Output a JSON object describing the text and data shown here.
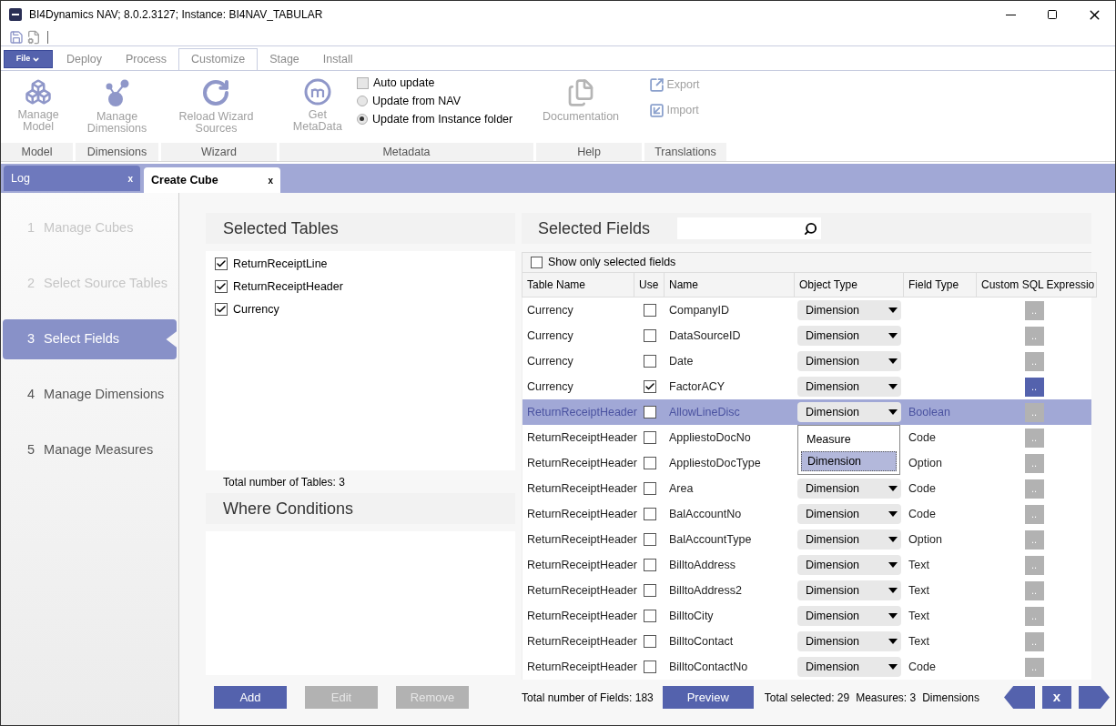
{
  "window": {
    "title": "BI4Dynamics NAV; 8.0.2.3127;  Instance: BI4NAV_TABULAR"
  },
  "file_menu": {
    "label": "File"
  },
  "ribbon_tabs": [
    {
      "label": "Deploy",
      "selected": false
    },
    {
      "label": "Process",
      "selected": false
    },
    {
      "label": "Customize",
      "selected": true
    },
    {
      "label": "Stage",
      "selected": false
    },
    {
      "label": "Install",
      "selected": false
    }
  ],
  "ribbon_groups": [
    {
      "label": "Model",
      "items": [
        {
          "kind": "large",
          "label": "Manage\nModel"
        }
      ]
    },
    {
      "label": "Dimensions",
      "items": [
        {
          "kind": "large",
          "label": "Manage\nDimensions"
        }
      ]
    },
    {
      "label": "Wizard",
      "items": [
        {
          "kind": "large",
          "label": "Reload Wizard\nSources"
        }
      ]
    },
    {
      "label": "Metadata",
      "items": [
        {
          "kind": "large",
          "label": "Get\nMetaData"
        },
        {
          "kind": "checkbox",
          "label": "Auto update",
          "checked": false
        },
        {
          "kind": "radio",
          "label": "Update from NAV",
          "selected": false
        },
        {
          "kind": "radio",
          "label": "Update from Instance folder",
          "selected": true
        }
      ]
    },
    {
      "label": "Help",
      "items": [
        {
          "kind": "large",
          "label": "Documentation"
        }
      ]
    },
    {
      "label": "Translations",
      "items": [
        {
          "kind": "small",
          "label": "Export"
        },
        {
          "kind": "small",
          "label": "Import"
        }
      ]
    }
  ],
  "doc_tabs": [
    {
      "label": "Log",
      "close": "x",
      "selected": false
    },
    {
      "label": "Create Cube",
      "close": "x",
      "selected": true
    }
  ],
  "steps": [
    {
      "number": "1",
      "label": "Manage Cubes",
      "selected": false,
      "disabled": true
    },
    {
      "number": "2",
      "label": "Select Source Tables",
      "selected": false,
      "disabled": true
    },
    {
      "number": "3",
      "label": "Select Fields",
      "selected": true,
      "disabled": false
    },
    {
      "number": "4",
      "label": "Manage Dimensions",
      "selected": false,
      "disabled": false
    },
    {
      "number": "5",
      "label": "Manage Measures",
      "selected": false,
      "disabled": false
    }
  ],
  "selected_tables": {
    "title": "Selected Tables",
    "items": [
      {
        "label": "ReturnReceiptLine",
        "checked": true
      },
      {
        "label": "ReturnReceiptHeader",
        "checked": true
      },
      {
        "label": "Currency",
        "checked": true
      }
    ],
    "total": "Total number of Tables: 3"
  },
  "where_conditions": {
    "title": "Where Conditions"
  },
  "condition_buttons": [
    {
      "label": "Add",
      "disabled": false
    },
    {
      "label": "Edit",
      "disabled": true
    },
    {
      "label": "Remove",
      "disabled": true
    }
  ],
  "selected_fields": {
    "title": "Selected Fields",
    "show_only": {
      "label": "Show only selected fields",
      "checked": false
    },
    "columns": [
      "Table Name",
      "Use",
      "Name",
      "Object Type",
      "Field Type",
      "Custom SQL Expressio"
    ],
    "rows": [
      {
        "table": "Currency",
        "use": false,
        "name": "CompanyID",
        "object_type": "Dimension",
        "sql": "..",
        "highlighted": false,
        "selected": false
      },
      {
        "table": "Currency",
        "use": false,
        "name": "DataSourceID",
        "object_type": "Dimension",
        "sql": "..",
        "highlighted": false,
        "selected": false
      },
      {
        "table": "Currency",
        "use": false,
        "name": "Date",
        "object_type": "Dimension",
        "sql": "..",
        "highlighted": false,
        "selected": false
      },
      {
        "table": "Currency",
        "use": true,
        "name": "FactorACY",
        "object_type": "Dimension",
        "sql": "..",
        "highlighted": true,
        "selected": false
      },
      {
        "table": "ReturnReceiptHeader",
        "use": false,
        "name": "AllowLineDisc",
        "object_type": "Dimension",
        "field_type": "Boolean",
        "sql": "..",
        "highlighted": false,
        "selected": true
      },
      {
        "table": "ReturnReceiptHeader",
        "use": false,
        "name": "AppliestoDocNo",
        "field_type": "Code",
        "sql": "..",
        "highlighted": false,
        "selected": false
      },
      {
        "table": "ReturnReceiptHeader",
        "use": false,
        "name": "AppliestoDocType",
        "field_type": "Option",
        "sql": "..",
        "highlighted": false,
        "selected": false
      },
      {
        "table": "ReturnReceiptHeader",
        "use": false,
        "name": "Area",
        "object_type": "Dimension",
        "field_type": "Code",
        "sql": "..",
        "highlighted": false,
        "selected": false
      },
      {
        "table": "ReturnReceiptHeader",
        "use": false,
        "name": "BalAccountNo",
        "object_type": "Dimension",
        "field_type": "Code",
        "sql": "..",
        "highlighted": false,
        "selected": false
      },
      {
        "table": "ReturnReceiptHeader",
        "use": false,
        "name": "BalAccountType",
        "object_type": "Dimension",
        "field_type": "Option",
        "sql": "..",
        "highlighted": false,
        "selected": false
      },
      {
        "table": "ReturnReceiptHeader",
        "use": false,
        "name": "BilltoAddress",
        "object_type": "Dimension",
        "field_type": "Text",
        "sql": "..",
        "highlighted": false,
        "selected": false
      },
      {
        "table": "ReturnReceiptHeader",
        "use": false,
        "name": "BilltoAddress2",
        "object_type": "Dimension",
        "field_type": "Text",
        "sql": "..",
        "highlighted": false,
        "selected": false
      },
      {
        "table": "ReturnReceiptHeader",
        "use": false,
        "name": "BilltoCity",
        "object_type": "Dimension",
        "field_type": "Text",
        "sql": "..",
        "highlighted": false,
        "selected": false
      },
      {
        "table": "ReturnReceiptHeader",
        "use": false,
        "name": "BilltoContact",
        "object_type": "Dimension",
        "field_type": "Text",
        "sql": "..",
        "highlighted": false,
        "selected": false
      },
      {
        "table": "ReturnReceiptHeader",
        "use": false,
        "name": "BilltoContactNo",
        "object_type": "Dimension",
        "field_type": "Code",
        "sql": "..",
        "highlighted": false,
        "selected": false
      }
    ],
    "dropdown": {
      "options": [
        {
          "label": "Measure",
          "selected": false
        },
        {
          "label": "Dimension",
          "selected": true
        }
      ]
    },
    "total": "Total number of Fields: 183",
    "preview": "Preview",
    "summary": [
      "Total selected: 29",
      "Measures: 3",
      "Dimensions"
    ]
  },
  "nav": {
    "close": "x"
  }
}
